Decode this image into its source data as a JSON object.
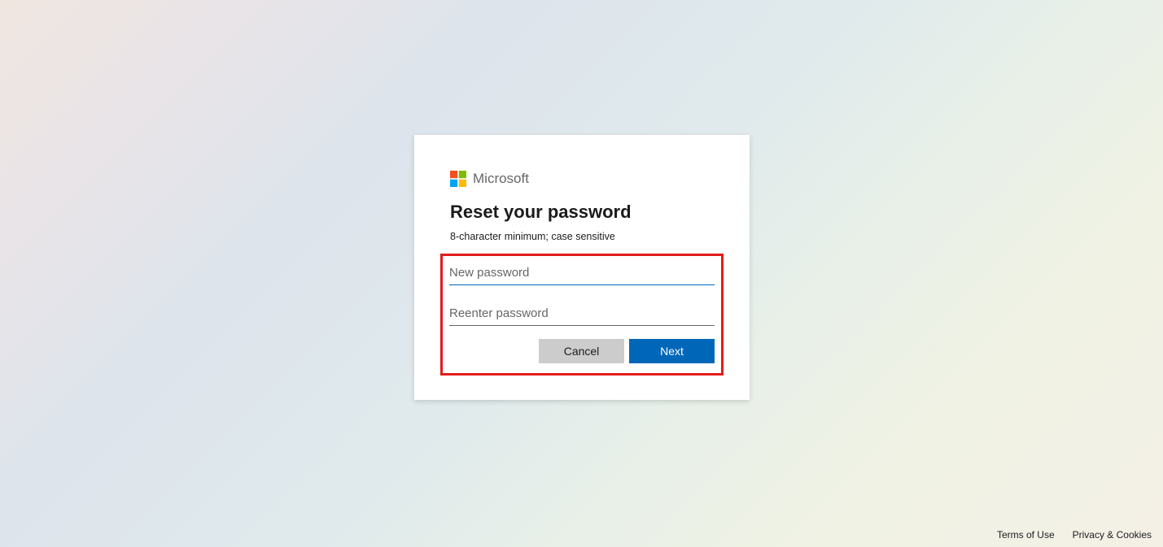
{
  "brand": {
    "name": "Microsoft"
  },
  "card": {
    "title": "Reset your password",
    "subtitle": "8-character minimum; case sensitive",
    "newPasswordPlaceholder": "New password",
    "reenterPasswordPlaceholder": "Reenter password",
    "newPasswordValue": "",
    "reenterPasswordValue": ""
  },
  "buttons": {
    "cancel": "Cancel",
    "next": "Next"
  },
  "footer": {
    "terms": "Terms of Use",
    "privacy": "Privacy & Cookies"
  }
}
